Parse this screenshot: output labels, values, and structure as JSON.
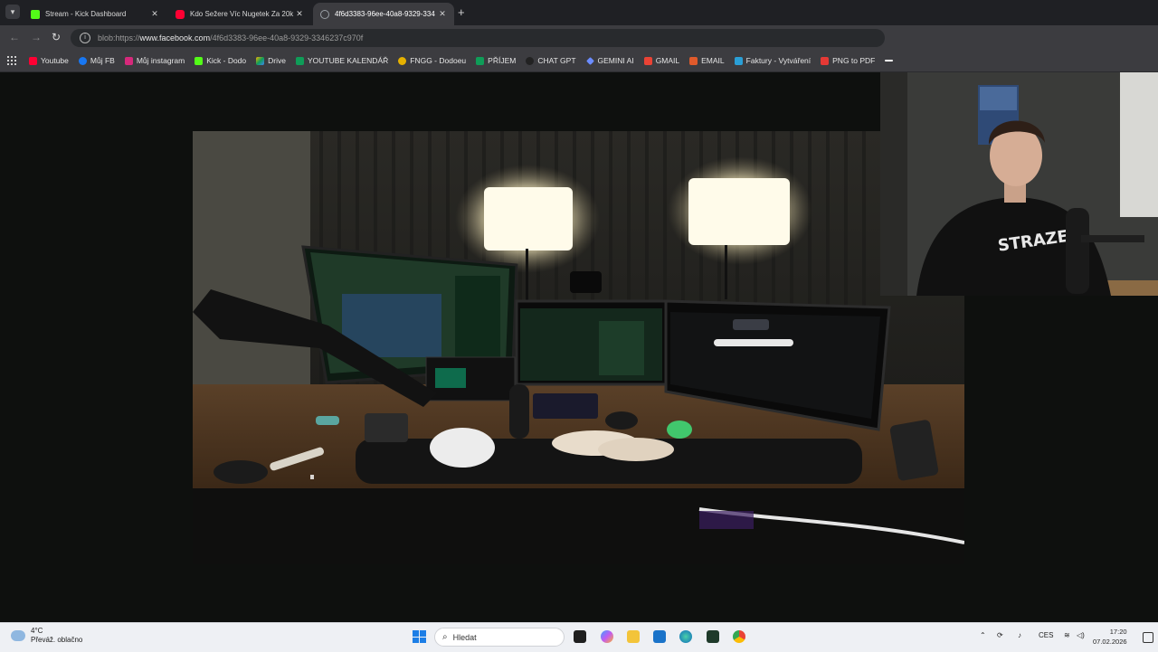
{
  "tabs": [
    {
      "title": "Stream - Kick Dashboard",
      "favicon": "kick-icon",
      "color": "#53fc18",
      "active": false
    },
    {
      "title": "Kdo Sežere Víc Nugetek Za 20k",
      "favicon": "youtube-icon",
      "color": "#ff0033",
      "active": false
    },
    {
      "title": "4f6d3383-96ee-40a8-9329-334",
      "favicon": "globe-icon",
      "color": "#9aa0a6",
      "active": true
    }
  ],
  "address": {
    "prefix": "blob:https://",
    "host": "www.facebook.com",
    "path": "/4f6d3383-96ee-40a8-9329-3346237c970f"
  },
  "bookmarks": [
    {
      "label": "Youtube",
      "icon": "youtube-icon",
      "color": "#ff0033"
    },
    {
      "label": "Můj FB",
      "icon": "facebook-icon",
      "color": "#1877f2"
    },
    {
      "label": "Můj instagram",
      "icon": "instagram-icon",
      "color": "#d6297b"
    },
    {
      "label": "Kick - Dodo",
      "icon": "kick-icon",
      "color": "#53fc18"
    },
    {
      "label": "Drive",
      "icon": "drive-icon",
      "color": "#f4b400"
    },
    {
      "label": "YOUTUBE KALENDÁŘ",
      "icon": "sheets-icon",
      "color": "#0f9d58"
    },
    {
      "label": "FNGG - Dodoeu",
      "icon": "fngg-icon",
      "color": "#e5b100"
    },
    {
      "label": "PŘÍJEM",
      "icon": "sheets-icon",
      "color": "#0f9d58"
    },
    {
      "label": "CHAT GPT",
      "icon": "openai-icon",
      "color": "#222222"
    },
    {
      "label": "GEMINI AI",
      "icon": "gemini-icon",
      "color": "#6b8cff"
    },
    {
      "label": "GMAIL",
      "icon": "gmail-icon",
      "color": "#ea4335"
    },
    {
      "label": "EMAIL",
      "icon": "email-icon",
      "color": "#e05a2b"
    },
    {
      "label": "Faktury - Vytváření",
      "icon": "invoice-icon",
      "color": "#2a9fd6"
    },
    {
      "label": "PNG to PDF",
      "icon": "pdf-icon",
      "color": "#e53935"
    }
  ],
  "taskbar": {
    "weather_temp": "4°C",
    "weather_desc": "Převáž. oblačno",
    "search_placeholder": "Hledat",
    "language": "CES",
    "time": "17:20",
    "date": "07.02.2026"
  }
}
